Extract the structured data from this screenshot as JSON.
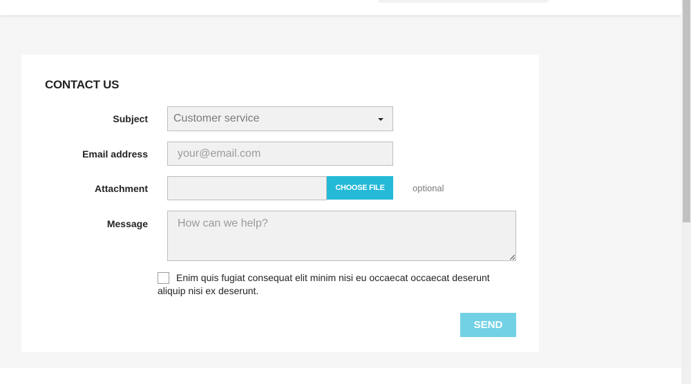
{
  "form": {
    "title": "CONTACT US",
    "subject_label": "Subject",
    "subject_value": "Customer service",
    "email_label": "Email address",
    "email_placeholder": "your@email.com",
    "attachment_label": "Attachment",
    "choose_file_label": "CHOOSE FILE",
    "optional_text": "optional",
    "message_label": "Message",
    "message_placeholder": "How can we help?",
    "consent_text": "Enim quis fugiat consequat elit minim nisi eu occaecat occaecat deserunt aliquip nisi ex deserunt.",
    "send_label": "SEND"
  },
  "colors": {
    "accent": "#24b9d7",
    "send_disabled": "#72d1e5"
  }
}
